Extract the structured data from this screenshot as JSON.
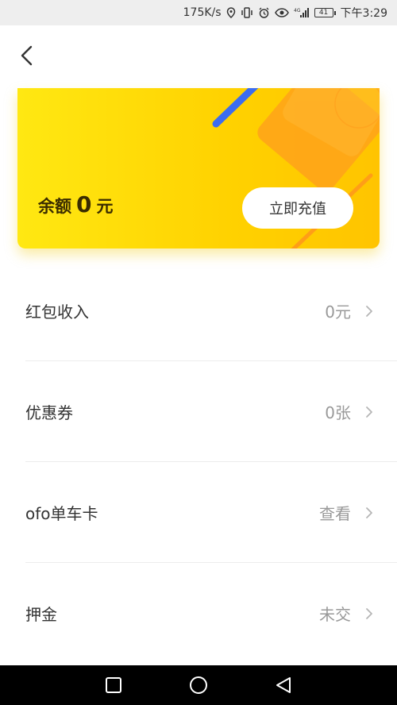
{
  "status_bar": {
    "speed": "175K/s",
    "battery": "41",
    "time": "下午3:29",
    "icons": [
      "location-icon",
      "vibrate-icon",
      "alarm-icon",
      "eye-icon",
      "signal-icon",
      "battery-icon"
    ]
  },
  "nav": {
    "back_icon": "back-arrow-icon"
  },
  "card": {
    "balance_label": "余额",
    "balance_amount": "0",
    "balance_unit": "元",
    "recharge_label": "立即充值",
    "colors": {
      "gradient_start": "#ffe812",
      "gradient_end": "#ffc400",
      "blue_stripe": "#3b6cf0",
      "orange_shape": "#ff9a1a"
    }
  },
  "list": {
    "items": [
      {
        "label": "红包收入",
        "value": "0元"
      },
      {
        "label": "优惠券",
        "value": "0张"
      },
      {
        "label": "ofo单车卡",
        "value": "查看"
      },
      {
        "label": "押金",
        "value": "未交"
      }
    ]
  },
  "system_nav": {
    "icons": [
      "square-icon",
      "circle-icon",
      "triangle-back-icon"
    ]
  }
}
